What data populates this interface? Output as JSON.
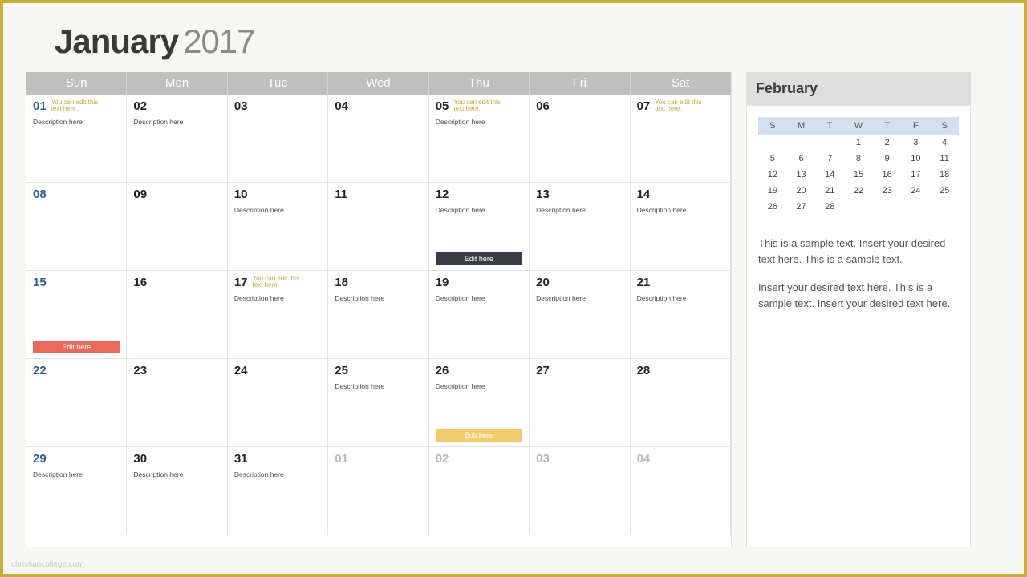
{
  "title": {
    "month": "January",
    "year": "2017"
  },
  "weekdays": [
    "Sun",
    "Mon",
    "Tue",
    "Wed",
    "Thu",
    "Fri",
    "Sat"
  ],
  "note_placeholder": "You can edit this text here.",
  "desc_placeholder": "Description here",
  "cells": [
    {
      "n": "01",
      "sun": true,
      "note": true,
      "desc": true
    },
    {
      "n": "02",
      "note": false,
      "desc": true
    },
    {
      "n": "03"
    },
    {
      "n": "04"
    },
    {
      "n": "05",
      "note": true,
      "desc": true
    },
    {
      "n": "06"
    },
    {
      "n": "07",
      "note": true
    },
    {
      "n": "08",
      "sun": true
    },
    {
      "n": "09"
    },
    {
      "n": "10",
      "desc": true
    },
    {
      "n": "11"
    },
    {
      "n": "12",
      "desc": true,
      "tag": "dark",
      "tag_text": "Edit here"
    },
    {
      "n": "13",
      "desc": true
    },
    {
      "n": "14",
      "desc": true
    },
    {
      "n": "15",
      "sun": true,
      "tag": "red",
      "tag_text": "Edit here"
    },
    {
      "n": "16"
    },
    {
      "n": "17",
      "note": true,
      "desc": true
    },
    {
      "n": "18",
      "desc": true
    },
    {
      "n": "19",
      "desc": true
    },
    {
      "n": "20",
      "desc": true
    },
    {
      "n": "21",
      "desc": true
    },
    {
      "n": "22",
      "sun": true
    },
    {
      "n": "23"
    },
    {
      "n": "24"
    },
    {
      "n": "25",
      "desc": true
    },
    {
      "n": "26",
      "desc": true,
      "tag": "yellow",
      "tag_text": "Edit here"
    },
    {
      "n": "27"
    },
    {
      "n": "28"
    },
    {
      "n": "29",
      "sun": true,
      "desc": true
    },
    {
      "n": "30",
      "desc": true
    },
    {
      "n": "31",
      "desc": true
    },
    {
      "n": "01",
      "muted": true
    },
    {
      "n": "02",
      "muted": true
    },
    {
      "n": "03",
      "muted": true
    },
    {
      "n": "04",
      "muted": true
    }
  ],
  "sidebar": {
    "title": "February",
    "head": [
      "S",
      "M",
      "T",
      "W",
      "T",
      "F",
      "S"
    ],
    "rows": [
      [
        "",
        "",
        "",
        "1",
        "2",
        "3",
        "4"
      ],
      [
        "5",
        "6",
        "7",
        "8",
        "9",
        "10",
        "11"
      ],
      [
        "12",
        "13",
        "14",
        "15",
        "16",
        "17",
        "18"
      ],
      [
        "19",
        "20",
        "21",
        "22",
        "23",
        "24",
        "25"
      ],
      [
        "26",
        "27",
        "28",
        "",
        "",
        "",
        ""
      ]
    ],
    "para1": "This is a sample text. Insert your desired text here. This is a sample text.",
    "para2": "Insert your desired text here. This is a sample text. Insert your desired text here."
  },
  "watermark": "christiancollege.com"
}
